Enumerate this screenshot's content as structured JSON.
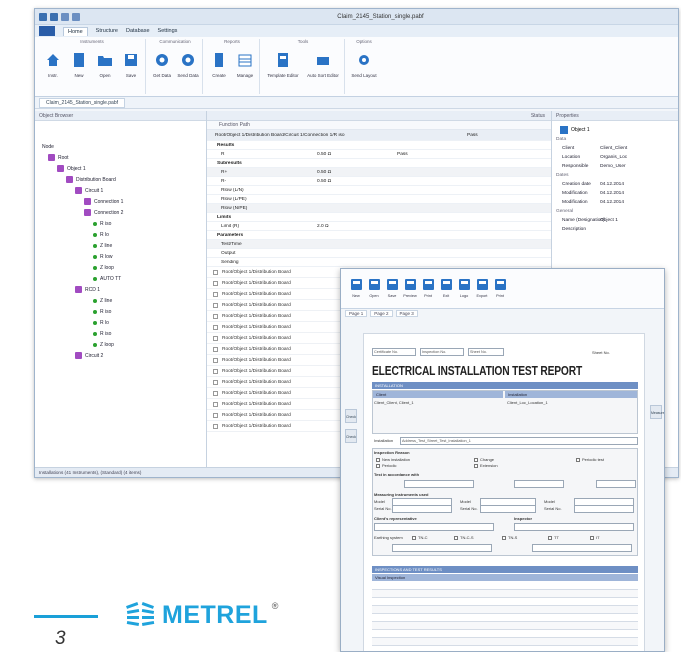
{
  "app": {
    "title": "Claim_2145_Station_single.pabf",
    "menu": {
      "file": "",
      "tabs": [
        "Home",
        "Structure",
        "Database",
        "Settings"
      ]
    },
    "ribbon_groups": [
      {
        "name": "Instruments",
        "buttons": [
          "Instr.",
          "New",
          "Open",
          "Save"
        ]
      },
      {
        "name": "Communication",
        "buttons": [
          "Get Data",
          "Send Data"
        ]
      },
      {
        "name": "Reports",
        "buttons": [
          "Create",
          "Manage"
        ]
      },
      {
        "name": "Tools",
        "buttons": [
          "Template Editor",
          "Auto Sort Editor"
        ]
      },
      {
        "name": "Options",
        "buttons": [
          "Send Layout"
        ]
      }
    ],
    "doc_tab": "Claim_2145_Station_single.pabf",
    "left_pane": {
      "header": "Object Browser",
      "tree": [
        {
          "label": "Node",
          "level": 0,
          "type": "root"
        },
        {
          "label": "Root",
          "level": 1,
          "type": "node"
        },
        {
          "label": "Object 1",
          "level": 2,
          "type": "node"
        },
        {
          "label": "Distribution Board",
          "level": 3,
          "type": "node"
        },
        {
          "label": "Circuit 1",
          "level": 4,
          "type": "node"
        },
        {
          "label": "Connection 1",
          "level": 5,
          "type": "node"
        },
        {
          "label": "Connection 2",
          "level": 5,
          "type": "node"
        },
        {
          "label": "R iso",
          "level": 6,
          "type": "dot"
        },
        {
          "label": "R lo",
          "level": 6,
          "type": "dot"
        },
        {
          "label": "Z line",
          "level": 6,
          "type": "dot"
        },
        {
          "label": "R low",
          "level": 6,
          "type": "dot"
        },
        {
          "label": "Z loop",
          "level": 6,
          "type": "dot"
        },
        {
          "label": "AUTO TT",
          "level": 6,
          "type": "dot"
        },
        {
          "label": "RCD 1",
          "level": 4,
          "type": "node"
        },
        {
          "label": "Z line",
          "level": 6,
          "type": "dot"
        },
        {
          "label": "R iso",
          "level": 6,
          "type": "dot"
        },
        {
          "label": "R lo",
          "level": 6,
          "type": "dot"
        },
        {
          "label": "R iso",
          "level": 6,
          "type": "dot"
        },
        {
          "label": "Z loop",
          "level": 6,
          "type": "dot"
        },
        {
          "label": "Circuit 2",
          "level": 4,
          "type": "node"
        }
      ]
    },
    "mid_pane": {
      "header_left": "",
      "header_right": "Status",
      "col_header": "Function Path",
      "main_row": {
        "path": "Root/Object 1/Distribution Board/Circuit 1/Connection 1/R iso",
        "status": "Pass"
      },
      "rows": [
        {
          "type": "sec",
          "name": "Results",
          "value": "",
          "status": ""
        },
        {
          "type": "item",
          "name": "R",
          "value": "0.50 Ω",
          "status": "Pass"
        },
        {
          "type": "sec",
          "name": "Subresults",
          "value": "",
          "status": ""
        },
        {
          "type": "item",
          "name": "R+",
          "value": "0.50 Ω",
          "status": ""
        },
        {
          "type": "item",
          "name": "R-",
          "value": "0.50 Ω",
          "status": ""
        },
        {
          "type": "item",
          "name": "Rlow (L/N)",
          "value": "",
          "status": ""
        },
        {
          "type": "item",
          "name": "Rlow (L/PE)",
          "value": "",
          "status": ""
        },
        {
          "type": "item",
          "name": "Rlow (N/PE)",
          "value": "",
          "status": ""
        },
        {
          "type": "sec",
          "name": "Limits",
          "value": "",
          "status": ""
        },
        {
          "type": "item",
          "name": "Limit (R)",
          "value": "2.0 Ω",
          "status": ""
        },
        {
          "type": "sec",
          "name": "Parameters",
          "value": "",
          "status": ""
        },
        {
          "type": "item",
          "name": "Test/Time",
          "value": "",
          "status": ""
        },
        {
          "type": "item",
          "name": "Output",
          "value": "",
          "status": ""
        },
        {
          "type": "item",
          "name": "Sending",
          "value": "",
          "status": ""
        }
      ],
      "path_rows": [
        "Root/Object 1/Distribution Board",
        "Root/Object 1/Distribution Board",
        "Root/Object 1/Distribution Board",
        "Root/Object 1/Distribution Board",
        "Root/Object 1/Distribution Board",
        "Root/Object 1/Distribution Board",
        "Root/Object 1/Distribution Board",
        "Root/Object 1/Distribution Board",
        "Root/Object 1/Distribution Board",
        "Root/Object 1/Distribution Board",
        "Root/Object 1/Distribution Board",
        "Root/Object 1/Distribution Board",
        "Root/Object 1/Distribution Board",
        "Root/Object 1/Distribution Board",
        "Root/Object 1/Distribution Board"
      ]
    },
    "right_pane": {
      "header": "Properties",
      "object_label": "Object 1",
      "categories": [
        {
          "name": "Data",
          "items": [
            {
              "k": "Client",
              "v": "Client_Client"
            },
            {
              "k": "Location",
              "v": "Organis_Loc"
            },
            {
              "k": "Responsible",
              "v": "Demo_User"
            }
          ]
        },
        {
          "name": "Dates",
          "items": [
            {
              "k": "Creation date",
              "v": "04.12.2014"
            },
            {
              "k": "Modification",
              "v": "04.12.2014"
            },
            {
              "k": "Modification",
              "v": "04.12.2014"
            }
          ]
        },
        {
          "name": "General",
          "items": [
            {
              "k": "Name (Designation)",
              "v": "Object 1"
            },
            {
              "k": "Description",
              "v": ""
            }
          ]
        }
      ]
    },
    "status_bar": "Installations (41 Instruments), (Standard) (4 items)"
  },
  "report": {
    "toolbar": [
      "New",
      "Open",
      "Save",
      "Preview",
      "Print",
      "Exit",
      "Logo",
      "Export",
      "Print"
    ],
    "tabs": [
      "Page 1",
      "Page 2",
      "Page 3"
    ],
    "title": "ELECTRICAL INSTALLATION TEST REPORT",
    "top_fields": [
      "Certificate No.",
      "Inspection No.",
      "Sheet No."
    ],
    "page_info": "Sheet No.",
    "section1": "INSTALLATION",
    "client_label": "Client",
    "installation_label": "Installation",
    "client_value": "Client_Client, Client_1",
    "installation_value": "Client_Loc_Location_1",
    "address_label": "Installation",
    "address_value": "Address_Test_Street_Test_Installation_1",
    "inspection_label": "Inspection Reason",
    "options": [
      "New installation",
      "Periodic",
      "Change",
      "Extension",
      "Periodic test"
    ],
    "connected_label": "Test in accordance with",
    "measure_label": "Measuring instruments used",
    "measure_fields": [
      "Model",
      "Serial No.",
      "Model",
      "Serial No.",
      "Model",
      "Serial No."
    ],
    "client_rep": "Client's representative",
    "inspector": "Inspector",
    "supply_label": "Earthing system",
    "supply_opts": [
      "TN-C",
      "TN-C-S",
      "TN-S",
      "TT",
      "IT"
    ],
    "section2": "INSPECTIONS AND TEST RESULTS",
    "section2_sub": "Visual Inspection",
    "side_labels": [
      "Check",
      "Check"
    ],
    "side_right": [
      "Measure"
    ]
  },
  "footer": {
    "page_number": "3",
    "brand": "METREL",
    "brand_mark": "®",
    "colors": {
      "brand": "#1fa3dc",
      "accent": "#1aa0d8"
    }
  }
}
